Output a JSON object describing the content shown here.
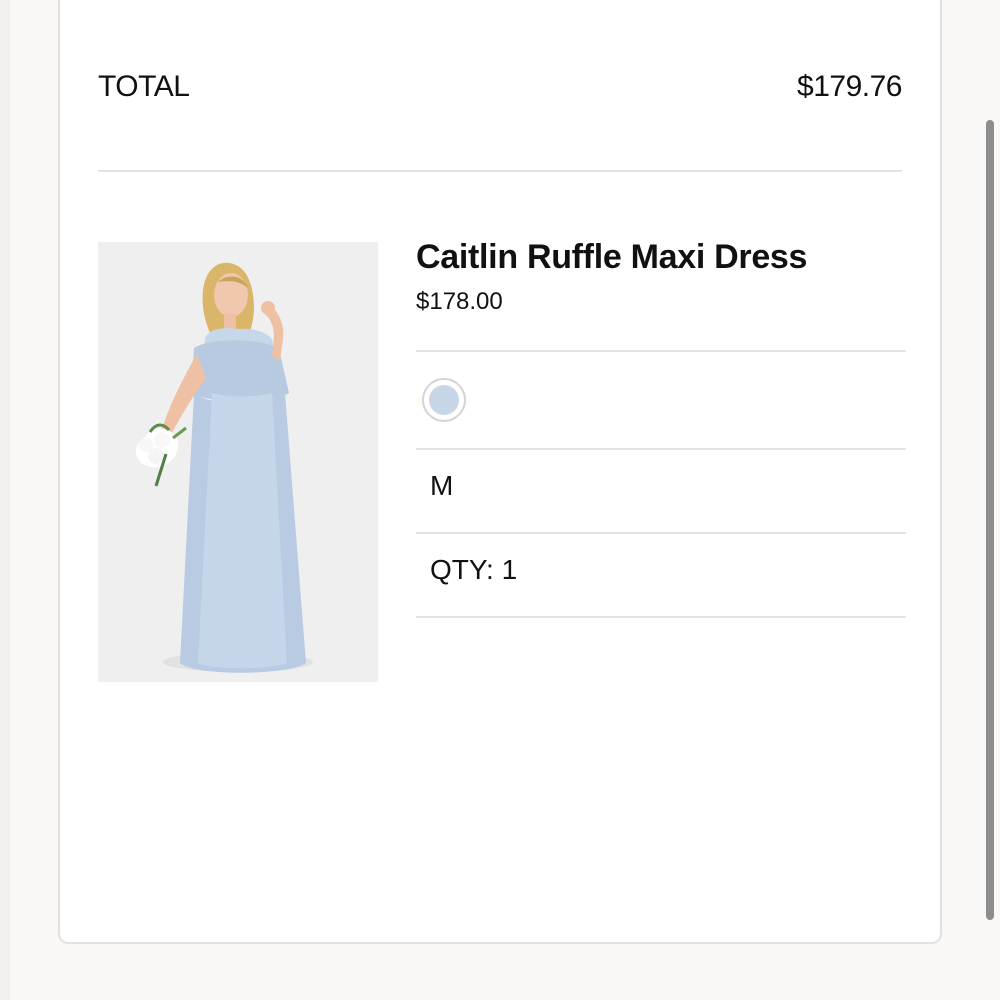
{
  "order_summary": {
    "total_label": "TOTAL",
    "total_value": "$179.76"
  },
  "product": {
    "name": "Caitlin Ruffle Maxi Dress",
    "price": "$178.00",
    "image_icon": "product-photo",
    "color_swatch": "#c7d6e7",
    "size": "M",
    "quantity_text": "QTY: 1"
  },
  "colors": {
    "card_border": "#e3e2df",
    "divider": "#e5e4e1",
    "dress_blue": "#b8cbe3",
    "scrollbar": "#8d8d8d"
  }
}
